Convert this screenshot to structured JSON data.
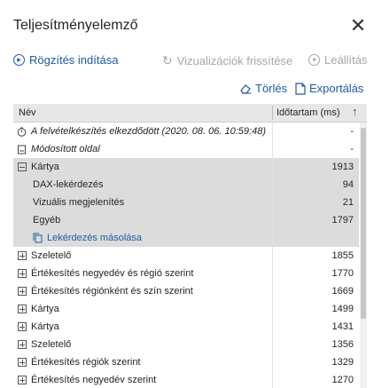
{
  "pane": {
    "title": "Teljesítményelemző",
    "close_glyph": "✕"
  },
  "toolbar": {
    "start_recording": "Rögzítés indítása",
    "refresh_visuals": "Vizualizációk frissítése",
    "stop": "Leállítás"
  },
  "actions": {
    "clear": "Törlés",
    "export": "Exportálás"
  },
  "table": {
    "col_name": "Név",
    "col_duration": "Időtartam (ms)",
    "sort_glyph": "↑",
    "rows": [
      {
        "name": "A felvételkészítés elkezdődött (2020. 08. 06. 10:59:48)",
        "duration": "-",
        "icon": "stopwatch-icon",
        "italic": true
      },
      {
        "name": "Módosított oldal",
        "duration": "-",
        "icon": "page-icon",
        "italic": true
      },
      {
        "name": "Kártya",
        "duration": "1913",
        "toggle": "minus"
      },
      {
        "name": "DAX-lekérdezés",
        "duration": "94"
      },
      {
        "name": "Vizuális megjelenítés",
        "duration": "21"
      },
      {
        "name": "Egyéb",
        "duration": "1797"
      },
      {
        "name": "Lekérdezés másolása",
        "duration": "",
        "link": true
      },
      {
        "name": "Szeletelő",
        "duration": "1855",
        "toggle": "plus"
      },
      {
        "name": "Értékesítés negyedév és régió szerint",
        "duration": "1770",
        "toggle": "plus"
      },
      {
        "name": "Értékesítés régiónként és szín szerint",
        "duration": "1669",
        "toggle": "plus"
      },
      {
        "name": "Kártya",
        "duration": "1499",
        "toggle": "plus"
      },
      {
        "name": "Kártya",
        "duration": "1431",
        "toggle": "plus"
      },
      {
        "name": "Szeletelő",
        "duration": "1356",
        "toggle": "plus"
      },
      {
        "name": "Értékesítés régiók szerint",
        "duration": "1329",
        "toggle": "plus"
      },
      {
        "name": "Értékesítés negyedév szerint",
        "duration": "1270",
        "toggle": "plus"
      }
    ]
  },
  "colors": {
    "accent": "#1e5ba5",
    "disabled": "#a6a6a6",
    "selected_bg": "#dcdcdc"
  }
}
